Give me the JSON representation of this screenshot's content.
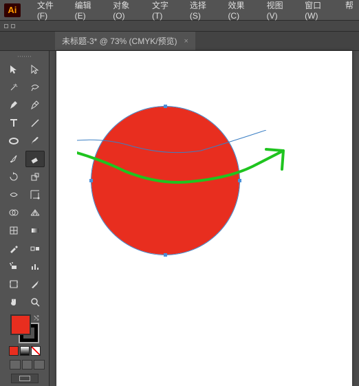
{
  "app": {
    "logo": "Ai"
  },
  "menu": {
    "file": "文件(F)",
    "edit": "编辑(E)",
    "object": "对象(O)",
    "type": "文字(T)",
    "select": "选择(S)",
    "effect": "效果(C)",
    "view": "视图(V)",
    "window": "窗口(W)",
    "help": "帮"
  },
  "tab": {
    "title": "未标题-3* @ 73% (CMYK/预览)",
    "close": "×"
  },
  "colors": {
    "fill": "#e82e1f",
    "stroke": "#000000",
    "canvas_shape": "#e82e1f",
    "blue_stroke": "#3b7fc4",
    "green_stroke": "#1fc41f",
    "swatch_red": "#e82e1f",
    "swatch_grad_a": "#ffffff",
    "swatch_grad_b": "#000000"
  }
}
